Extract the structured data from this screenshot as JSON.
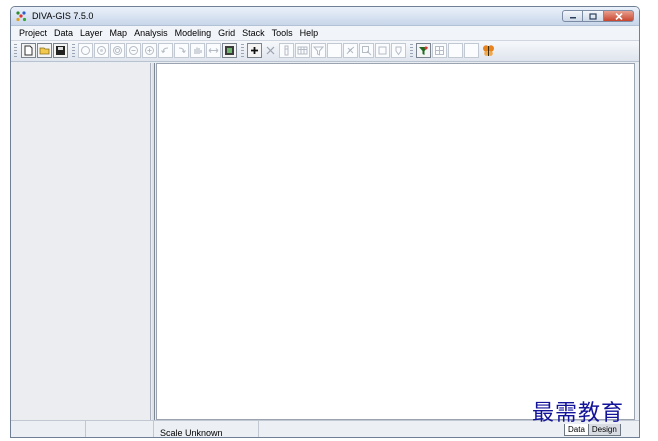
{
  "window": {
    "title": "DIVA-GIS 7.5.0",
    "controls": [
      "minimize",
      "maximize",
      "close"
    ]
  },
  "menubar": {
    "items": [
      "Project",
      "Data",
      "Layer",
      "Map",
      "Analysis",
      "Modeling",
      "Grid",
      "Stack",
      "Tools",
      "Help"
    ]
  },
  "toolbar": {
    "buttons": [
      {
        "icon": "new-file-icon",
        "enabled": true
      },
      {
        "icon": "open-folder-icon",
        "enabled": true
      },
      {
        "icon": "save-icon",
        "enabled": true
      },
      {
        "icon": "zoom-in-icon",
        "enabled": false
      },
      {
        "icon": "zoom-out-icon",
        "enabled": false
      },
      {
        "icon": "zoom-full-icon",
        "enabled": false
      },
      {
        "icon": "zoom-layer-icon",
        "enabled": false
      },
      {
        "icon": "zoom-selection-icon",
        "enabled": false
      },
      {
        "icon": "zoom-previous-icon",
        "enabled": false
      },
      {
        "icon": "zoom-next-icon",
        "enabled": false
      },
      {
        "icon": "pan-hand-icon",
        "enabled": false
      },
      {
        "icon": "measure-icon",
        "enabled": false
      },
      {
        "icon": "map-image-icon",
        "enabled": true
      },
      {
        "icon": "add-layer-icon",
        "enabled": true
      },
      {
        "icon": "remove-layer-icon",
        "enabled": false
      },
      {
        "icon": "identify-icon",
        "enabled": false
      },
      {
        "icon": "attribute-table-icon",
        "enabled": false
      },
      {
        "icon": "filter-icon",
        "enabled": false
      },
      {
        "icon": "blank-tool-icon",
        "enabled": false
      },
      {
        "icon": "select-tool-icon",
        "enabled": false
      },
      {
        "icon": "select-rectangle-icon",
        "enabled": false
      },
      {
        "icon": "select-square-icon",
        "enabled": false
      },
      {
        "icon": "clear-selection-icon",
        "enabled": false
      },
      {
        "icon": "legend-icon",
        "enabled": true
      },
      {
        "icon": "grid-icon",
        "enabled": false
      },
      {
        "icon": "blank-tool-2-icon",
        "enabled": false
      },
      {
        "icon": "blank-tool-3-icon",
        "enabled": false
      },
      {
        "icon": "butterfly-icon",
        "enabled": true
      }
    ]
  },
  "statusbar": {
    "scale_text": "Scale Unknown"
  },
  "tabs": [
    "Data",
    "Design"
  ],
  "watermark": "最需教育"
}
